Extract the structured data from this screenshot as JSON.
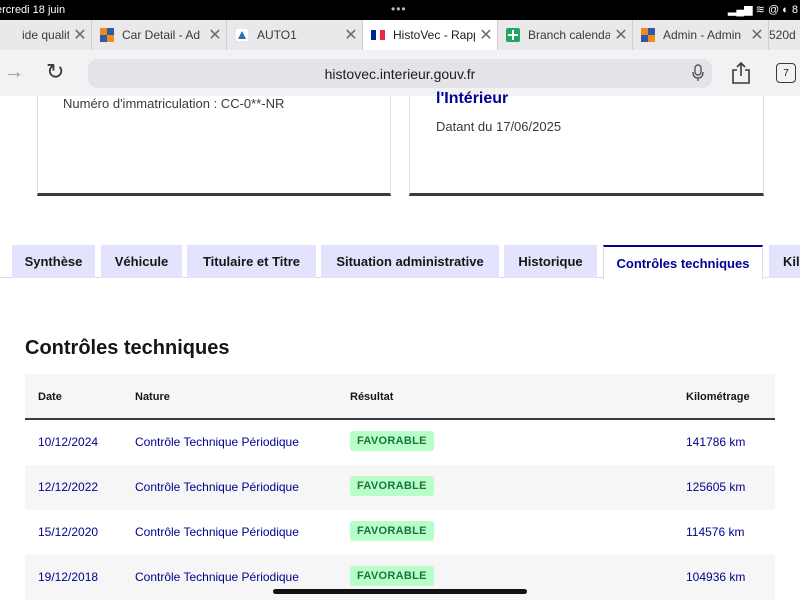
{
  "status_bar": {
    "date": "ercredi 18 juin",
    "dots": "•••",
    "system": "▂▄▆ ≋ @ ◐ 8"
  },
  "browser": {
    "tabs": [
      {
        "title": "ide qualité -",
        "favicon": "blank",
        "active": false
      },
      {
        "title": "Car Detail - Ad",
        "favicon": "orange-blue-grid",
        "active": false
      },
      {
        "title": "AUTO1",
        "favicon": "auto1-logo",
        "active": false
      },
      {
        "title": "HistoVec - Rapp",
        "favicon": "french-flag",
        "active": true
      },
      {
        "title": "Branch calenda",
        "favicon": "green-sheet",
        "active": false
      },
      {
        "title": "Admin - Admin",
        "favicon": "orange-blue-grid",
        "active": false
      },
      {
        "title": "520d",
        "favicon": "blank",
        "active": false
      }
    ],
    "close_glyph": "✕",
    "url": "histovec.interieur.gouv.fr",
    "tab_count": "7",
    "forward_glyph": "→",
    "reload_glyph": "↻"
  },
  "report": {
    "plate_label": "Numéro d'immatriculation : CC-0**-NR",
    "ministry": "l'Intérieur",
    "dated": "Datant du 17/06/2025"
  },
  "section_tabs": [
    {
      "label": "Synthèse",
      "active": false
    },
    {
      "label": "Véhicule",
      "active": false
    },
    {
      "label": "Titulaire et Titre",
      "active": false
    },
    {
      "label": "Situation administrative",
      "active": false
    },
    {
      "label": "Historique",
      "active": false
    },
    {
      "label": "Contrôles techniques",
      "active": true
    },
    {
      "label": "Kilo",
      "active": false
    }
  ],
  "inspections": {
    "title": "Contrôles techniques",
    "columns": [
      "Date",
      "Nature",
      "Résultat",
      "Kilométrage"
    ],
    "rows": [
      {
        "date": "10/12/2024",
        "nature": "Contrôle Technique Périodique",
        "result": "FAVORABLE",
        "km": "141786 km"
      },
      {
        "date": "12/12/2022",
        "nature": "Contrôle Technique Périodique",
        "result": "FAVORABLE",
        "km": "125605 km"
      },
      {
        "date": "15/12/2020",
        "nature": "Contrôle Technique Périodique",
        "result": "FAVORABLE",
        "km": "114576 km"
      },
      {
        "date": "19/12/2018",
        "nature": "Contrôle Technique Périodique",
        "result": "FAVORABLE",
        "km": "104936 km"
      }
    ]
  },
  "colors": {
    "accent": "#000091",
    "tab_bg": "#e3e3fd",
    "badge_bg": "#b8fec9",
    "badge_text": "#18753c"
  }
}
